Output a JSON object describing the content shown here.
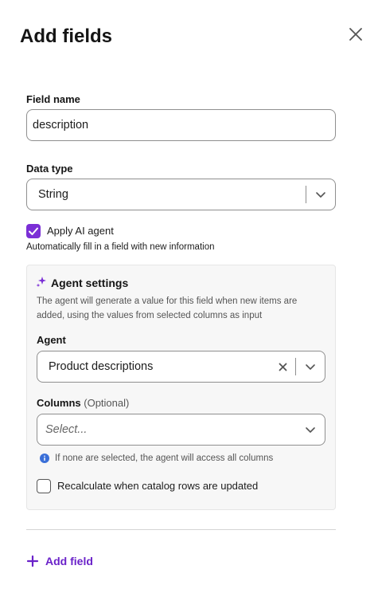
{
  "header": {
    "title": "Add fields"
  },
  "field_name": {
    "label": "Field name",
    "value": "description"
  },
  "data_type": {
    "label": "Data type",
    "value": "String"
  },
  "ai_agent": {
    "label": "Apply AI agent",
    "checked": true,
    "description": "Automatically fill in a field with new information"
  },
  "agent_settings": {
    "title": "Agent settings",
    "description_line1": "The agent will generate a value for this field when new items are",
    "description_line2": "added, using the values from selected columns as input",
    "agent_label": "Agent",
    "agent_value": "Product descriptions",
    "columns_label": "Columns",
    "columns_optional": "(Optional)",
    "columns_placeholder": "Select...",
    "info_text": "If none are selected, the agent will access all columns",
    "recalc_label": "Recalculate when catalog rows are updated",
    "recalc_checked": false
  },
  "footer": {
    "add_field_label": "Add field"
  },
  "colors": {
    "accent": "#7b2fd6",
    "accent_text": "#6a22c9",
    "info": "#3a6fd8"
  }
}
